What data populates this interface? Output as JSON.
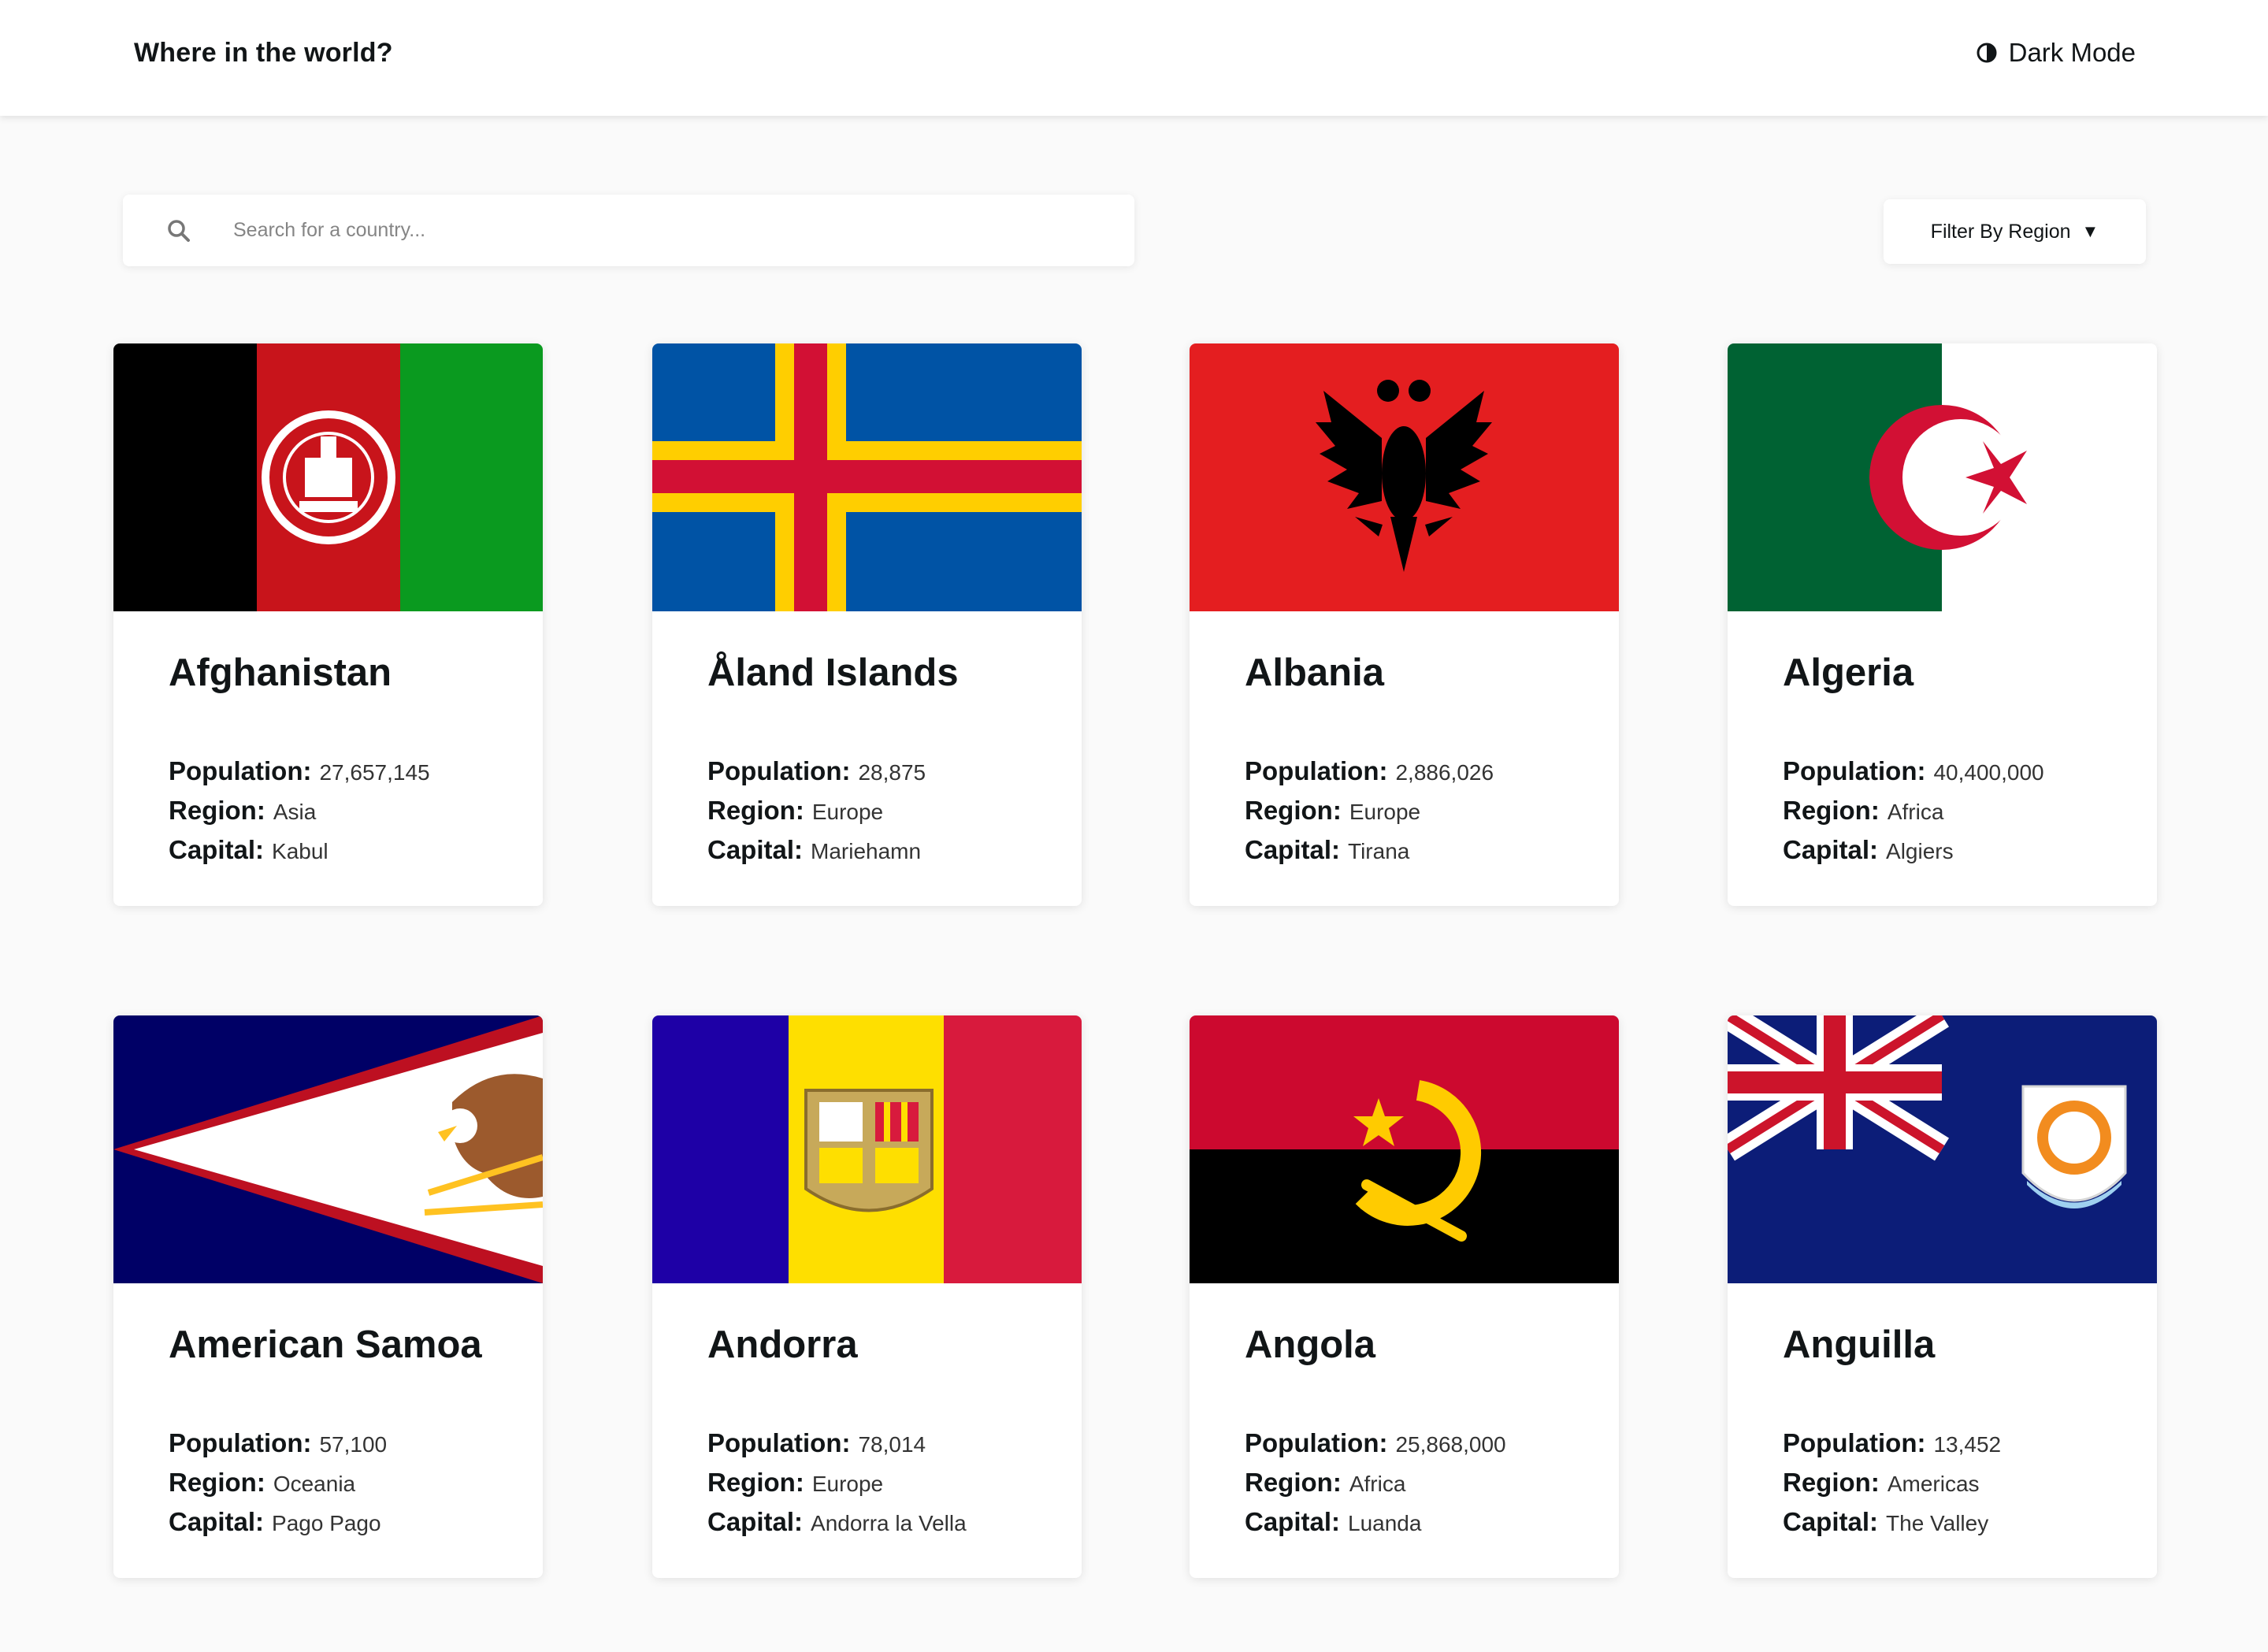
{
  "header": {
    "title": "Where in the world?",
    "theme_toggle_label": "Dark Mode",
    "theme_icon": "half-moon-icon"
  },
  "search": {
    "placeholder": "Search for a country...",
    "value": "",
    "icon": "search-icon"
  },
  "filter": {
    "label": "Filter By Region",
    "caret": "▼"
  },
  "labels": {
    "population": "Population:",
    "region": "Region:",
    "capital": "Capital:"
  },
  "countries": [
    {
      "name": "Afghanistan",
      "population": "27,657,145",
      "region": "Asia",
      "capital": "Kabul",
      "flag": "afghanistan-flag"
    },
    {
      "name": "Åland Islands",
      "population": "28,875",
      "region": "Europe",
      "capital": "Mariehamn",
      "flag": "aland-islands-flag"
    },
    {
      "name": "Albania",
      "population": "2,886,026",
      "region": "Europe",
      "capital": "Tirana",
      "flag": "albania-flag"
    },
    {
      "name": "Algeria",
      "population": "40,400,000",
      "region": "Africa",
      "capital": "Algiers",
      "flag": "algeria-flag"
    },
    {
      "name": "American Samoa",
      "population": "57,100",
      "region": "Oceania",
      "capital": "Pago Pago",
      "flag": "american-samoa-flag"
    },
    {
      "name": "Andorra",
      "population": "78,014",
      "region": "Europe",
      "capital": "Andorra la Vella",
      "flag": "andorra-flag"
    },
    {
      "name": "Angola",
      "population": "25,868,000",
      "region": "Africa",
      "capital": "Luanda",
      "flag": "angola-flag"
    },
    {
      "name": "Anguilla",
      "population": "13,452",
      "region": "Americas",
      "capital": "The Valley",
      "flag": "anguilla-flag"
    }
  ],
  "colors": {
    "background": "#fafafa",
    "surface": "#ffffff",
    "text": "#111517",
    "placeholder": "#858585"
  }
}
